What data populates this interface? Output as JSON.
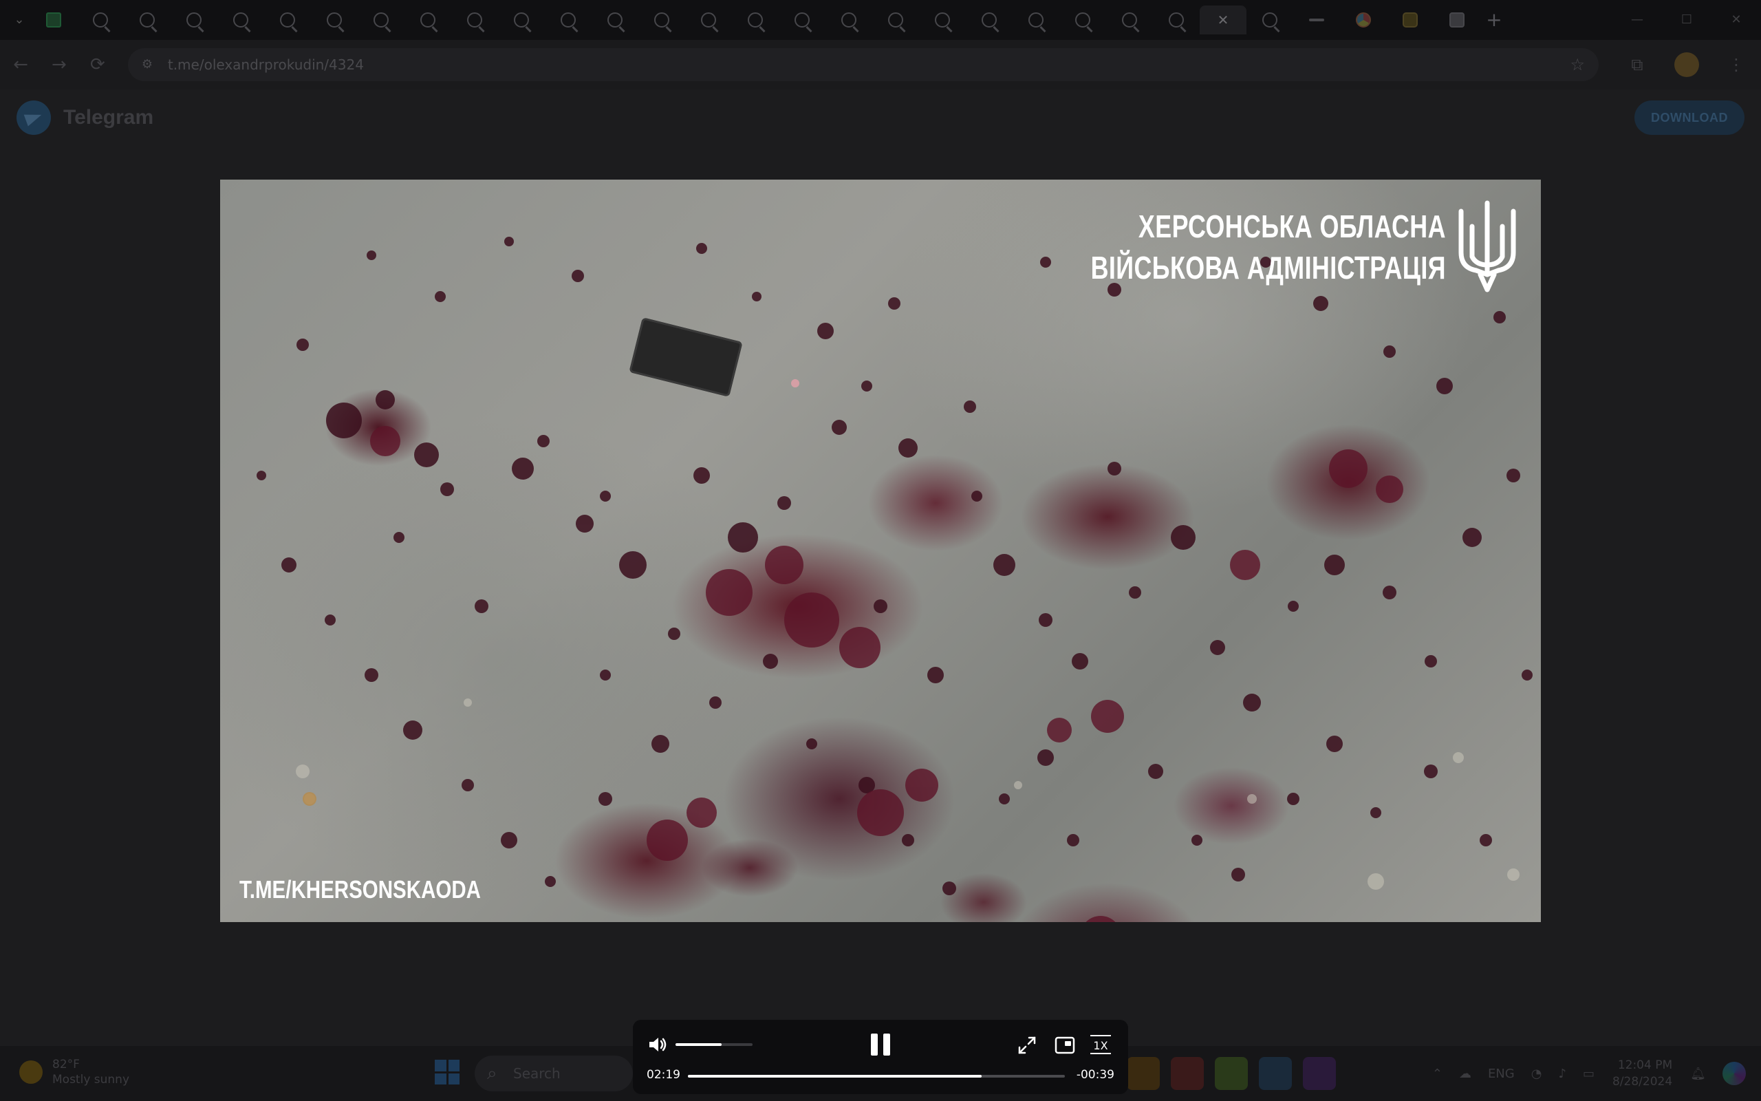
{
  "browser": {
    "tab_count": 32,
    "url": "t.me/olexandrprokudin/4324",
    "new_tab_label": "+"
  },
  "page": {
    "brand_name": "Telegram",
    "download_label": "DOWNLOAD"
  },
  "video": {
    "watermark_line1": "ХЕРСОНСЬКА ОБЛАСНА",
    "watermark_line2": "ВІЙСЬКОВА АДМІНІСТРАЦІЯ",
    "watermark_bottom": "T.ME/KHERSONSKAODA"
  },
  "player": {
    "current_time": "02:19",
    "remaining_time": "-00:39",
    "speed_label": "1X",
    "progress_fraction": 0.78,
    "volume_fraction": 0.6
  },
  "taskbar": {
    "weather_temp": "82°F",
    "weather_desc": "Mostly sunny",
    "search_placeholder": "Search",
    "language": "ENG",
    "time": "12:04 PM",
    "date": "8/28/2024"
  },
  "colors": {
    "player_bg": "#0d0d0f",
    "accent_white": "#ffffff",
    "telegram_blue": "#2aabee"
  }
}
